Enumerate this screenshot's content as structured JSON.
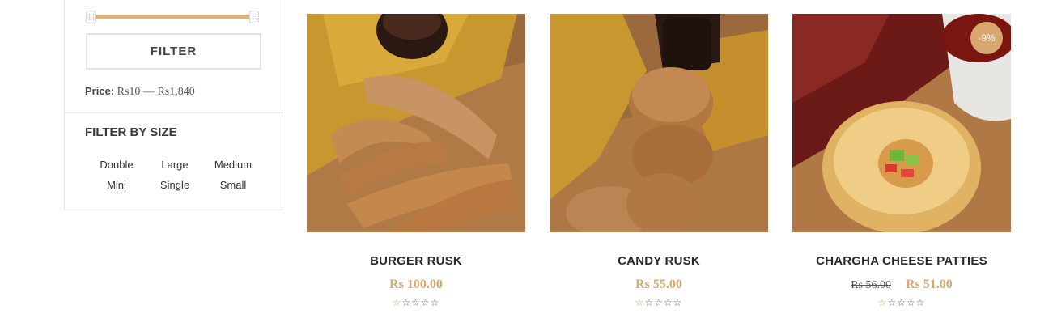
{
  "sidebar": {
    "filter_button": "FILTER",
    "price_label": "Price:",
    "price_min": "Rs10",
    "price_sep": "—",
    "price_max": "Rs1,840",
    "size_title": "FILTER BY SIZE",
    "sizes": [
      "Double",
      "Large",
      "Medium",
      "Mini",
      "Single",
      "Small"
    ]
  },
  "products": [
    {
      "title": "BURGER RUSK",
      "price": "Rs 100.00",
      "rating": "☆☆☆☆☆",
      "image": "burger-rusk-photo"
    },
    {
      "title": "CANDY RUSK",
      "price": "Rs 55.00",
      "rating": "☆☆☆☆☆",
      "image": "candy-rusk-photo"
    },
    {
      "title": "CHARGHA CHEESE PATTIES",
      "old_price": "Rs 56.00",
      "price": "Rs 51.00",
      "badge": "-9%",
      "rating": "☆☆☆☆☆",
      "image": "cheese-patties-photo"
    }
  ],
  "colors": {
    "accent": "#d8a66f",
    "slider": "#dcb27f",
    "border": "#e6e6e6"
  }
}
